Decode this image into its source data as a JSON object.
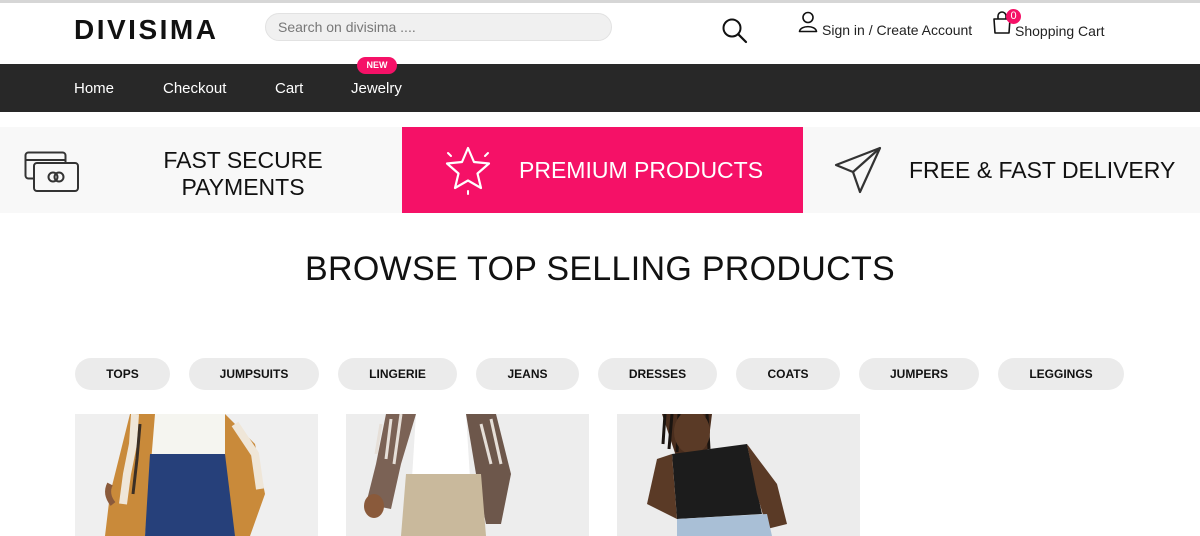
{
  "header": {
    "logo": "DIVISIMA",
    "search_placeholder": "Search on divisima ....",
    "account_label": "Sign in / Create Account",
    "cart_label": "Shopping Cart",
    "cart_count": "0"
  },
  "nav": {
    "items": [
      {
        "label": "Home"
      },
      {
        "label": "Checkout"
      },
      {
        "label": "Cart"
      },
      {
        "label": "Jewelry"
      }
    ],
    "badge": "NEW"
  },
  "features": [
    {
      "line1": "FAST SECURE",
      "line2": "PAYMENTS",
      "icon": "credit-card-icon"
    },
    {
      "line1": "PREMIUM PRODUCTS",
      "icon": "star-icon"
    },
    {
      "line1": "FREE & FAST DELIVERY",
      "icon": "paper-plane-icon"
    }
  ],
  "browse": {
    "title": "BROWSE TOP SELLING PRODUCTS",
    "categories": [
      "TOPS",
      "JUMPSUITS",
      "LINGERIE",
      "JEANS",
      "DRESSES",
      "COATS",
      "JUMPERS",
      "LEGGINGS"
    ]
  },
  "colors": {
    "accent": "#f51167",
    "nav_bg": "#282828",
    "feature_bg": "#f8f8f8",
    "pill_bg": "#ebebeb"
  }
}
